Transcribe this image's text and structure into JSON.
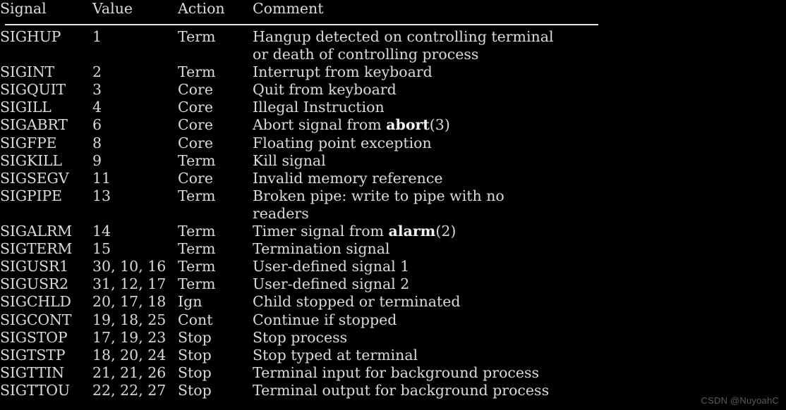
{
  "page": {
    "background_color": "#000000",
    "text_color": "#d9d9e0",
    "bold_text_color": "#f2f2f5",
    "rule_color": "#e6e6ea"
  },
  "table": {
    "headers": {
      "signal": "Signal",
      "value": "Value",
      "action": "Action",
      "comment": "Comment"
    },
    "rows": [
      {
        "signal": "SIGHUP",
        "value": "1",
        "action": "Term",
        "comment": "Hangup detected on controlling terminal\nor death of controlling process"
      },
      {
        "signal": "SIGINT",
        "value": "2",
        "action": "Term",
        "comment": "Interrupt from keyboard"
      },
      {
        "signal": "SIGQUIT",
        "value": "3",
        "action": "Core",
        "comment": "Quit from keyboard"
      },
      {
        "signal": "SIGILL",
        "value": "4",
        "action": "Core",
        "comment": "Illegal Instruction"
      },
      {
        "signal": "SIGABRT",
        "value": "6",
        "action": "Core",
        "comment": "Abort signal from abort(3)",
        "comment_bold_segment": "abort",
        "comment_prefix": "Abort signal from ",
        "comment_suffix": "(3)"
      },
      {
        "signal": "SIGFPE",
        "value": "8",
        "action": "Core",
        "comment": "Floating point exception"
      },
      {
        "signal": "SIGKILL",
        "value": "9",
        "action": "Term",
        "comment": "Kill signal"
      },
      {
        "signal": "SIGSEGV",
        "value": "11",
        "action": "Core",
        "comment": "Invalid memory reference"
      },
      {
        "signal": "SIGPIPE",
        "value": "13",
        "action": "Term",
        "comment": "Broken pipe: write to pipe with no\nreaders"
      },
      {
        "signal": "SIGALRM",
        "value": "14",
        "action": "Term",
        "comment": "Timer signal from alarm(2)",
        "comment_bold_segment": "alarm",
        "comment_prefix": "Timer signal from ",
        "comment_suffix": "(2)"
      },
      {
        "signal": "SIGTERM",
        "value": "15",
        "action": "Term",
        "comment": "Termination signal"
      },
      {
        "signal": "SIGUSR1",
        "value": "30, 10, 16",
        "action": "Term",
        "comment": "User-defined signal 1"
      },
      {
        "signal": "SIGUSR2",
        "value": "31, 12, 17",
        "action": "Term",
        "comment": "User-defined signal 2"
      },
      {
        "signal": "SIGCHLD",
        "value": "20, 17, 18",
        "action": "Ign",
        "comment": "Child stopped or terminated"
      },
      {
        "signal": "SIGCONT",
        "value": "19, 18, 25",
        "action": "Cont",
        "comment": "Continue if stopped"
      },
      {
        "signal": "SIGSTOP",
        "value": "17, 19, 23",
        "action": "Stop",
        "comment": "Stop process"
      },
      {
        "signal": "SIGTSTP",
        "value": "18, 20, 24",
        "action": "Stop",
        "comment": "Stop typed at terminal"
      },
      {
        "signal": "SIGTTIN",
        "value": "21, 21, 26",
        "action": "Stop",
        "comment": "Terminal input for background process"
      },
      {
        "signal": "SIGTTOU",
        "value": "22, 22, 27",
        "action": "Stop",
        "comment": "Terminal output for background process"
      }
    ]
  },
  "watermark": {
    "text": "CSDN @NuyoahC"
  }
}
